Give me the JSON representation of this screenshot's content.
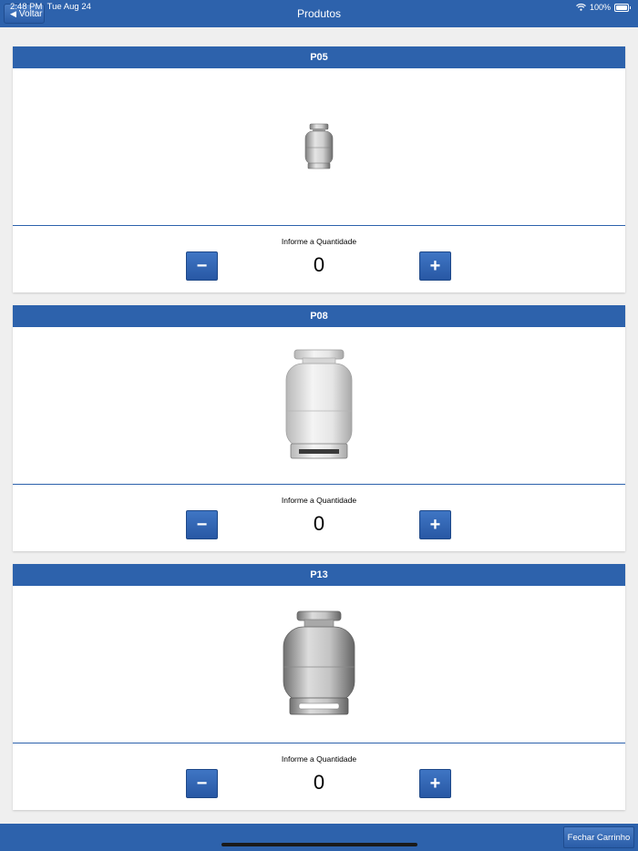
{
  "status_bar": {
    "time": "2:48 PM",
    "date": "Tue Aug 24",
    "battery": "100%"
  },
  "nav": {
    "back_label": "Voltar",
    "title": "Produtos"
  },
  "products": [
    {
      "name": "P05",
      "quantity_label": "Informe a Quantidade",
      "quantity": "0",
      "minus_label": "−",
      "plus_label": "+"
    },
    {
      "name": "P08",
      "quantity_label": "Informe a Quantidade",
      "quantity": "0",
      "minus_label": "−",
      "plus_label": "+"
    },
    {
      "name": "P13",
      "quantity_label": "Informe a Quantidade",
      "quantity": "0",
      "minus_label": "−",
      "plus_label": "+"
    }
  ],
  "footer": {
    "checkout_label": "Fechar Carrinho"
  },
  "colors": {
    "primary": "#2d62ac",
    "background": "#efefef"
  }
}
